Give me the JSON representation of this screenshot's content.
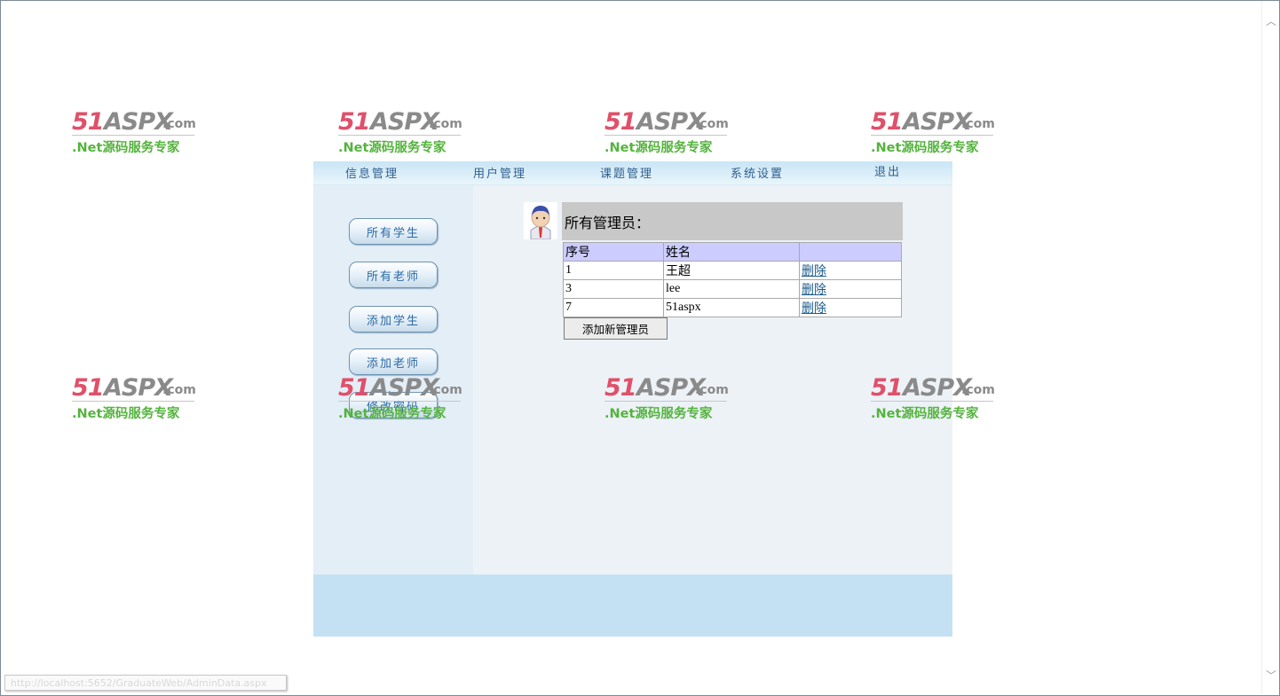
{
  "watermark": {
    "brand_51": "51",
    "brand_aspx": "ASPX",
    "brand_com": ".com",
    "subtitle": ".Net源码服务专家"
  },
  "topnav": {
    "items": [
      "信息管理",
      "用户管理",
      "课题管理",
      "系统设置",
      "退出"
    ]
  },
  "sidebar": {
    "buttons": [
      "所有学生",
      "所有老师",
      "添加学生",
      "添加老师",
      "修改密码"
    ]
  },
  "main": {
    "title": "所有管理员：",
    "table": {
      "headers": [
        "序号",
        "姓名",
        ""
      ],
      "rows": [
        {
          "id": "1",
          "name": "王超",
          "action": "删除"
        },
        {
          "id": "3",
          "name": "lee",
          "action": "删除"
        },
        {
          "id": "7",
          "name": "51aspx",
          "action": "删除"
        }
      ]
    },
    "add_button": "添加新管理员"
  },
  "status_bar": {
    "url": "http://localhost:5652/GraduateWeb/AdminData.aspx"
  },
  "colors": {
    "watermark_red": "#e0506a",
    "watermark_green": "#55b33e",
    "nav_text": "#2f5f8f",
    "table_header_bg": "#ccccff",
    "title_bar_bg": "#c8c8c8"
  }
}
